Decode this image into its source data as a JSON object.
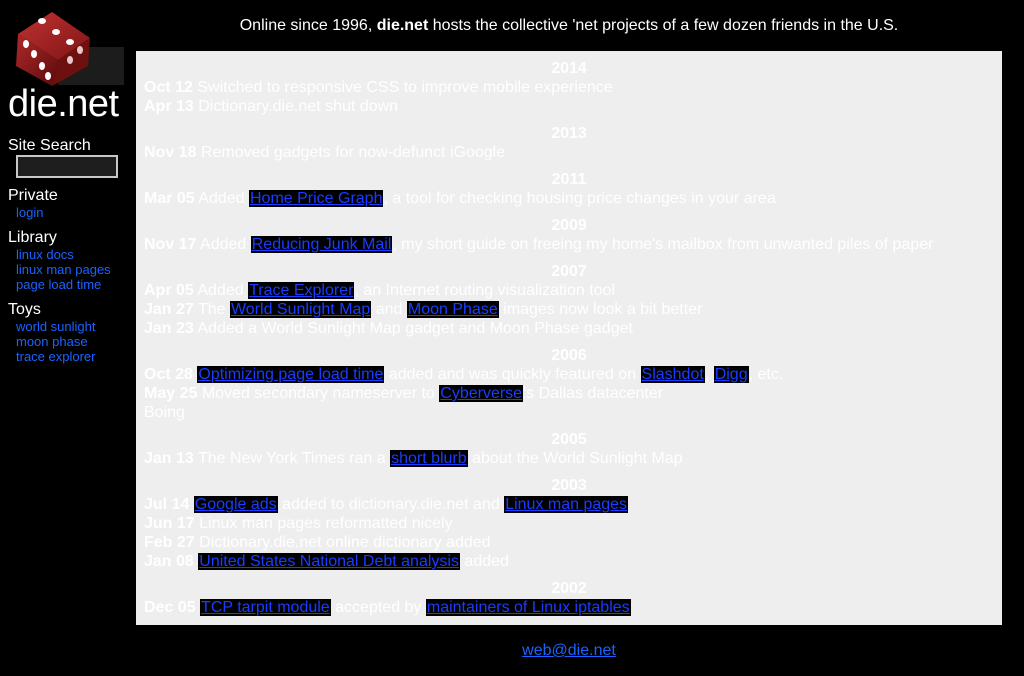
{
  "site": {
    "name": "die.net",
    "tagline_prefix": "Online since 1996, ",
    "tagline_bold": "die.net",
    "tagline_suffix": " hosts the collective 'net projects of a few dozen friends in the U.S."
  },
  "sidebar": {
    "search_title": "Site Search",
    "search_value": "",
    "private_title": "Private",
    "private_links": [
      "login"
    ],
    "library_title": "Library",
    "library_links": [
      "linux docs",
      "linux man pages",
      "page load time"
    ],
    "toys_title": "Toys",
    "toys_links": [
      "world sunlight",
      "moon phase",
      "trace explorer"
    ]
  },
  "news": [
    {
      "year": "2014",
      "entries": [
        {
          "date": "Oct 12",
          "parts": [
            {
              "t": " Switched to responsive CSS to improve mobile experience"
            }
          ]
        },
        {
          "date": "Apr 13",
          "parts": [
            {
              "t": " Dictionary.die.net shut down"
            }
          ]
        }
      ]
    },
    {
      "year": "2013",
      "entries": [
        {
          "date": "Nov 18",
          "parts": [
            {
              "t": " Removed gadgets for now-defunct iGoogle"
            }
          ]
        }
      ]
    },
    {
      "year": "2011",
      "entries": [
        {
          "date": "Mar 05",
          "parts": [
            {
              "t": " Added "
            },
            {
              "link": "Home Price Graph"
            },
            {
              "t": ", a tool for checking housing price changes in your area"
            }
          ]
        }
      ]
    },
    {
      "year": "2009",
      "entries": [
        {
          "date": "Nov 17",
          "parts": [
            {
              "t": " Added "
            },
            {
              "link": "Reducing Junk Mail"
            },
            {
              "t": ", my short guide on freeing my home's mailbox from unwanted piles of paper"
            }
          ]
        }
      ]
    },
    {
      "year": "2007",
      "entries": [
        {
          "date": "Apr 05",
          "parts": [
            {
              "t": " Added "
            },
            {
              "link": "Trace Explorer"
            },
            {
              "t": ", an Internet routing visualization tool"
            }
          ]
        },
        {
          "date": "Jan 27",
          "parts": [
            {
              "t": " The "
            },
            {
              "link": "World Sunlight Map"
            },
            {
              "t": " and "
            },
            {
              "link": "Moon Phase"
            },
            {
              "t": " images now look a bit better"
            }
          ]
        },
        {
          "date": "Jan 23",
          "parts": [
            {
              "t": " Added a World Sunlight Map gadget and Moon Phase gadget"
            }
          ]
        }
      ]
    },
    {
      "year": "2006",
      "entries": [
        {
          "date": "Oct 28",
          "parts": [
            {
              "t": " "
            },
            {
              "link": "Optimizing page load time"
            },
            {
              "t": " added and was quickly featured on "
            },
            {
              "link": "Slashdot"
            },
            {
              "t": ", "
            },
            {
              "link": "Digg"
            },
            {
              "t": ", etc."
            }
          ]
        },
        {
          "date": "May 25",
          "parts": [
            {
              "t": " Moved secondary nameserver to "
            },
            {
              "link": "Cyberverse"
            },
            {
              "t": "'s Dallas datacenter"
            }
          ]
        },
        {
          "date": "",
          "parts": [
            {
              "t": "Boing"
            }
          ]
        }
      ]
    },
    {
      "year": "2005",
      "entries": [
        {
          "date": "Jan 13",
          "parts": [
            {
              "t": " The New York Times ran a "
            },
            {
              "link": "short blurb"
            },
            {
              "t": " about the World Sunlight Map"
            }
          ]
        }
      ]
    },
    {
      "year": "2003",
      "entries": [
        {
          "date": "Jul 14",
          "parts": [
            {
              "t": " "
            },
            {
              "link": "Google ads"
            },
            {
              "t": " added to dictionary.die.net and "
            },
            {
              "link": "Linux man pages"
            }
          ]
        },
        {
          "date": "Jun 17",
          "parts": [
            {
              "t": " Linux man pages reformatted nicely"
            }
          ]
        },
        {
          "date": "Feb 27",
          "parts": [
            {
              "t": " Dictionary.die.net online dictionary added"
            }
          ]
        },
        {
          "date": "Jan 08",
          "parts": [
            {
              "t": " "
            },
            {
              "link": "United States National Debt analysis"
            },
            {
              "t": " added"
            }
          ]
        }
      ]
    },
    {
      "year": "2002",
      "entries": [
        {
          "date": "Dec 05",
          "parts": [
            {
              "t": " "
            },
            {
              "link": "TCP tarpit module"
            },
            {
              "t": " accepted by "
            },
            {
              "link": "maintainers of Linux iptables"
            }
          ]
        }
      ]
    }
  ],
  "footer": {
    "email": "web@die.net"
  },
  "colors": {
    "link": "#1a3cff",
    "panel": "#eeeeee",
    "background": "#000000",
    "dice": "#8b1a1a"
  },
  "icons": {
    "logo": "red-dice-logo"
  }
}
